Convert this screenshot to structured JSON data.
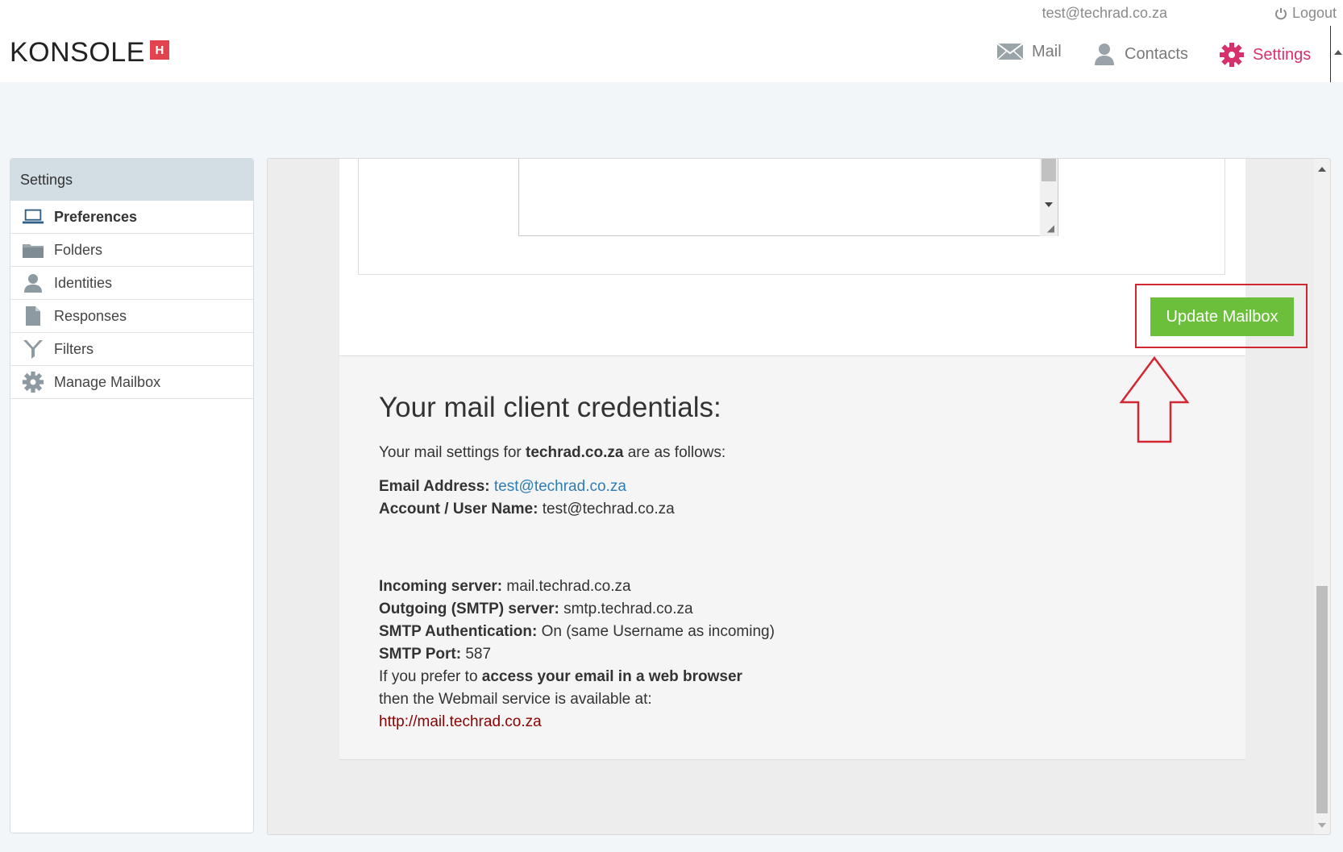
{
  "topbar": {
    "user_email": "test@techrad.co.za",
    "logout_label": "Logout"
  },
  "brand": {
    "name": "KONSOLE",
    "badge": "H",
    "badge_color": "#e2444f"
  },
  "nav": {
    "mail": "Mail",
    "contacts": "Contacts",
    "settings": "Settings",
    "active_color": "#d7306c"
  },
  "sidebar": {
    "title": "Settings",
    "items": [
      {
        "label": "Preferences",
        "icon": "laptop-icon",
        "active": true
      },
      {
        "label": "Folders",
        "icon": "folder-icon"
      },
      {
        "label": "Identities",
        "icon": "person-icon"
      },
      {
        "label": "Responses",
        "icon": "document-icon"
      },
      {
        "label": "Filters",
        "icon": "filter-icon"
      },
      {
        "label": "Manage Mailbox",
        "icon": "gear-icon"
      }
    ]
  },
  "main": {
    "update_button": "Update Mailbox",
    "button_color": "#6bbf3a",
    "highlight_color": "#d22630",
    "credentials": {
      "heading": "Your mail client credentials:",
      "intro_prefix": "Your mail settings for",
      "domain": "techrad.co.za",
      "intro_suffix": "are as follows:",
      "email_label": "Email Address:",
      "email_value": "test@techrad.co.za",
      "account_label": "Account / User Name:",
      "account_value": "test@techrad.co.za",
      "incoming_label": "Incoming server:",
      "incoming_value": "mail.techrad.co.za",
      "outgoing_label": "Outgoing (SMTP) server:",
      "outgoing_value": "smtp.techrad.co.za",
      "auth_label": "SMTP Authentication:",
      "auth_value": "On (same Username as incoming)",
      "port_label": "SMTP Port:",
      "port_value": "587",
      "webmail_prefix": "If you prefer to",
      "webmail_bold": "access your email in a web browser",
      "webmail_line2": "then the Webmail service is available at:",
      "webmail_url": "http://mail.techrad.co.za"
    }
  }
}
